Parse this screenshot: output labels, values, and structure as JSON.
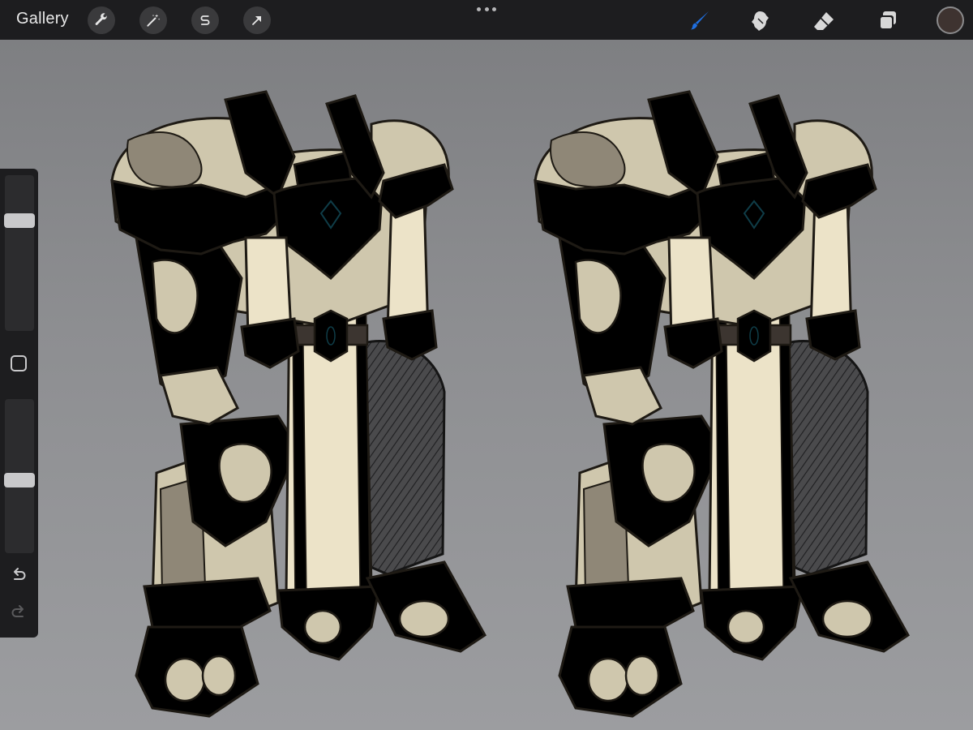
{
  "toolbar": {
    "gallery_label": "Gallery",
    "left_tools": [
      "wrench-icon",
      "magic-wand-icon",
      "selection-s-icon",
      "transform-arrow-icon"
    ],
    "right_tools": [
      "brush-icon",
      "smudge-icon",
      "eraser-icon",
      "layers-icon"
    ],
    "active_tool": "brush-icon",
    "accent_color": "#1f6fe0",
    "current_color": "#3e3330"
  },
  "sidebar": {
    "brush_size_level": 0.73,
    "opacity_level": 0.47,
    "icons": [
      "modify-square-icon",
      "undo-icon",
      "redo-icon"
    ]
  },
  "canvas": {
    "description_colors": {
      "gold_trim": "#e0a83a",
      "bronze_trim": "#a87648",
      "plate": "#cfc7ad",
      "shadow_plate": "#8f8777",
      "cloth": "#ece3c8",
      "gem": "#1fc7e6",
      "dark_leg": "#3a3a3c",
      "background_top": "#7c7d80",
      "background_bottom": "#9c9da0"
    }
  }
}
